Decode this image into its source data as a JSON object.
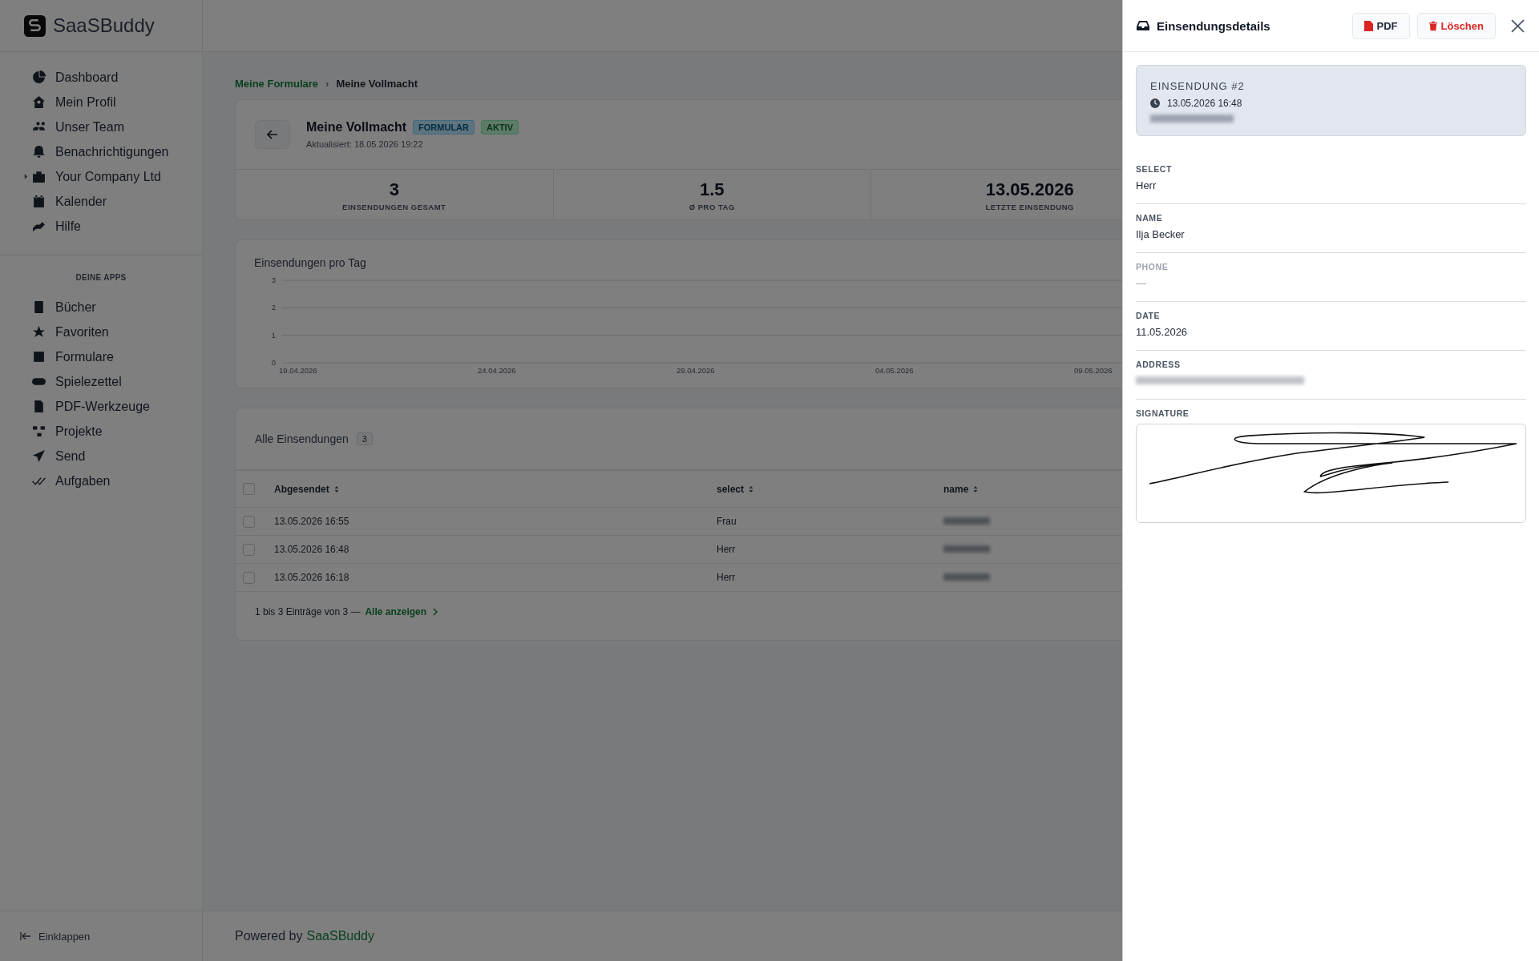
{
  "app": {
    "name": "SaaSBuddy"
  },
  "sidebar": {
    "items": [
      {
        "label": "Dashboard",
        "kind": "link"
      },
      {
        "label": "Mein Profil",
        "kind": "link"
      },
      {
        "label": "Unser Team",
        "kind": "link"
      },
      {
        "label": "Benachrichtigungen",
        "kind": "link"
      },
      {
        "label": "Your Company Ltd",
        "kind": "group",
        "expanded": false
      },
      {
        "label": "Kalender",
        "kind": "link"
      },
      {
        "label": "Hilfe",
        "kind": "link"
      }
    ],
    "section_title": "DEINE APPS",
    "apps": [
      {
        "label": "Bücher"
      },
      {
        "label": "Favoriten"
      },
      {
        "label": "Formulare"
      },
      {
        "label": "Spielezettel"
      },
      {
        "label": "PDF-Werkzeuge"
      },
      {
        "label": "Projekte"
      },
      {
        "label": "Send"
      },
      {
        "label": "Aufgaben"
      }
    ],
    "collapse": "Einklappen"
  },
  "breadcrumb": {
    "separator": "›",
    "items": [
      {
        "label": "Meine Formulare",
        "kind": "link"
      },
      {
        "label": "Meine Vollmacht",
        "kind": "current"
      }
    ]
  },
  "form": {
    "title": "Meine Vollmacht",
    "badges": [
      {
        "label": "FORMULAR",
        "kind": "type"
      },
      {
        "label": "AKTIV",
        "kind": "status"
      }
    ],
    "updated": "Aktualisiert: 18.05.2026 19:22"
  },
  "stats": [
    {
      "value": "3",
      "label": "EINSENDUNGEN GESAMT"
    },
    {
      "value": "1.5",
      "label": "Ø PRO TAG"
    },
    {
      "value": "13.05.2026",
      "label": "LETZTE EINSENDUNG"
    }
  ],
  "chart": {
    "chart_data": {
      "type": "line",
      "title": "Einsendungen pro Tag",
      "categories": [
        "19.04.2026",
        "24.04.2026",
        "29.04.2026",
        "04.05.2026",
        "09.05.2026"
      ],
      "ylim": [
        0,
        3
      ],
      "yticks": [
        0,
        1,
        2,
        3
      ]
    }
  },
  "submissions": {
    "title": "Alle Einsendungen",
    "count": "3",
    "all_checked": false,
    "columns": [
      "Abgesendet",
      "select",
      "name"
    ],
    "rows": [
      {
        "sent": "13.05.2026 16:55",
        "select": "Frau",
        "checked": false
      },
      {
        "sent": "13.05.2026 16:48",
        "select": "Herr",
        "checked": false
      },
      {
        "sent": "13.05.2026 16:18",
        "select": "Herr",
        "checked": false
      }
    ],
    "footer": "1 bis 3 Einträge von 3 —",
    "show_all": "Alle anzeigen"
  },
  "footer": {
    "prefix": "Powered by",
    "brand": "SaaSBuddy"
  },
  "panel": {
    "title": "Einsendungsdetails",
    "pdf": "PDF",
    "delete": "Löschen",
    "summary": {
      "heading": "EINSENDUNG #2",
      "date": "13.05.2026 16:48"
    },
    "fields": [
      {
        "label": "SELECT",
        "kind": "text",
        "value": "Herr",
        "empty": false
      },
      {
        "label": "NAME",
        "kind": "text",
        "value": "Ilja Becker",
        "empty": false
      },
      {
        "label": "PHONE",
        "kind": "text",
        "value": "—",
        "empty": true
      },
      {
        "label": "DATE",
        "kind": "text",
        "value": "11.05.2026",
        "empty": false
      },
      {
        "label": "ADDRESS",
        "kind": "redacted",
        "empty": false
      },
      {
        "label": "SIGNATURE",
        "kind": "signature",
        "empty": false
      }
    ]
  }
}
